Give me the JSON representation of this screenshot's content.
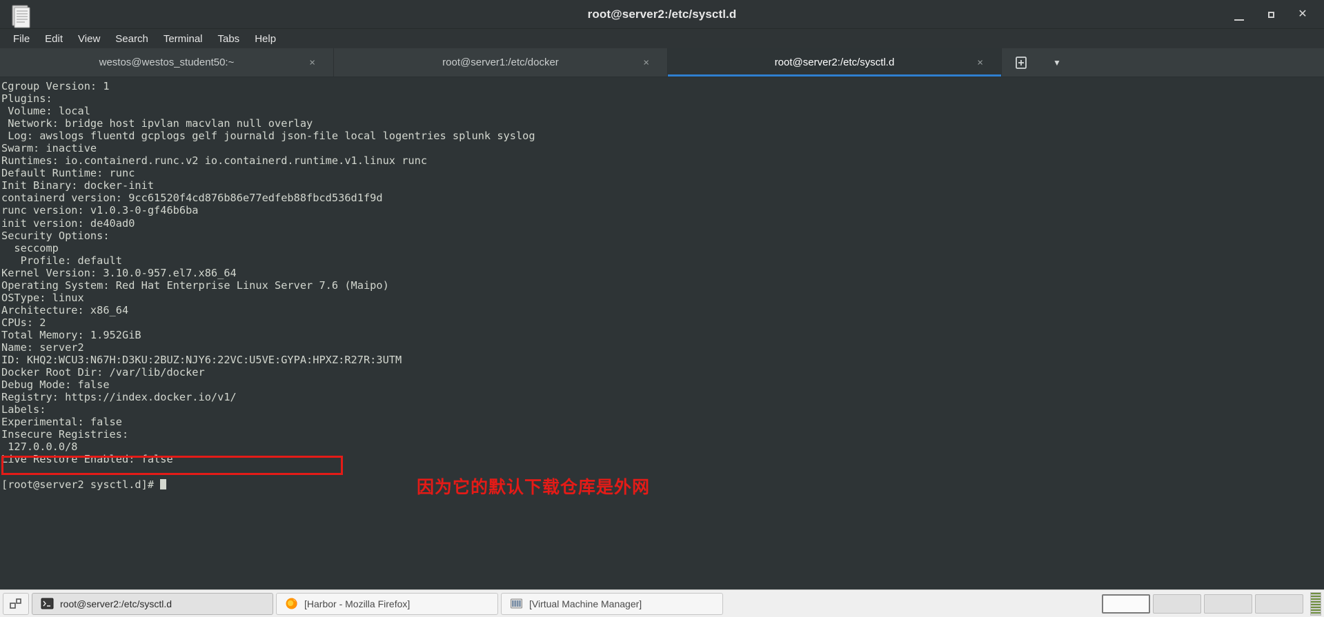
{
  "window": {
    "title": "root@server2:/etc/sysctl.d",
    "icon_name": "terminal-document-icon",
    "minimize_label": "Minimize",
    "maximize_label": "Maximize",
    "close_label": "✕"
  },
  "menubar": {
    "items": [
      {
        "label": "File"
      },
      {
        "label": "Edit"
      },
      {
        "label": "View"
      },
      {
        "label": "Search"
      },
      {
        "label": "Terminal"
      },
      {
        "label": "Tabs"
      },
      {
        "label": "Help"
      }
    ]
  },
  "tabs": {
    "items": [
      {
        "label": "westos@westos_student50:~",
        "close": "×",
        "active": false
      },
      {
        "label": "root@server1:/etc/docker",
        "close": "×",
        "active": false
      },
      {
        "label": "root@server2:/etc/sysctl.d",
        "close": "×",
        "active": true
      }
    ],
    "new_tab_label": "New Tab",
    "tab_menu_label": "▼"
  },
  "terminal": {
    "lines": [
      "Cgroup Version: 1",
      "Plugins:",
      " Volume: local",
      " Network: bridge host ipvlan macvlan null overlay",
      " Log: awslogs fluentd gcplogs gelf journald json-file local logentries splunk syslog",
      "Swarm: inactive",
      "Runtimes: io.containerd.runc.v2 io.containerd.runtime.v1.linux runc",
      "Default Runtime: runc",
      "Init Binary: docker-init",
      "containerd version: 9cc61520f4cd876b86e77edfeb88fbcd536d1f9d",
      "runc version: v1.0.3-0-gf46b6ba",
      "init version: de40ad0",
      "Security Options:",
      "  seccomp",
      "   Profile: default",
      "Kernel Version: 3.10.0-957.el7.x86_64",
      "Operating System: Red Hat Enterprise Linux Server 7.6 (Maipo)",
      "OSType: linux",
      "Architecture: x86_64",
      "CPUs: 2",
      "Total Memory: 1.952GiB",
      "Name: server2",
      "ID: KHQ2:WCU3:N67H:D3KU:2BUZ:NJY6:22VC:U5VE:GYPA:HPXZ:R27R:3UTM",
      "Docker Root Dir: /var/lib/docker",
      "Debug Mode: false",
      "Registry: https://index.docker.io/v1/",
      "Labels:",
      "Experimental: false",
      "Insecure Registries:",
      " 127.0.0.0/8",
      "Live Restore Enabled: false",
      "",
      "[root@server2 sysctl.d]# "
    ]
  },
  "annotations": {
    "highlight_box_label": "registry-line-highlight",
    "note_text": "因为它的默认下载仓库是外网",
    "highlight_color": "#e41b17"
  },
  "taskbar": {
    "workspace_switcher_label": "workspace-switcher",
    "tasks": [
      {
        "label": "root@server2:/etc/sysctl.d",
        "icon": "terminal-icon",
        "active": true
      },
      {
        "label": "[Harbor - Mozilla Firefox]",
        "icon": "firefox-icon",
        "active": false
      },
      {
        "label": "[Virtual Machine Manager]",
        "icon": "virt-manager-icon",
        "active": false
      }
    ],
    "pager": [
      {
        "label": "workspace-1",
        "active": true
      },
      {
        "label": "workspace-2",
        "active": false
      },
      {
        "label": "workspace-3",
        "active": false
      },
      {
        "label": "workspace-4",
        "active": false
      }
    ],
    "systray_label": "system-tray"
  }
}
